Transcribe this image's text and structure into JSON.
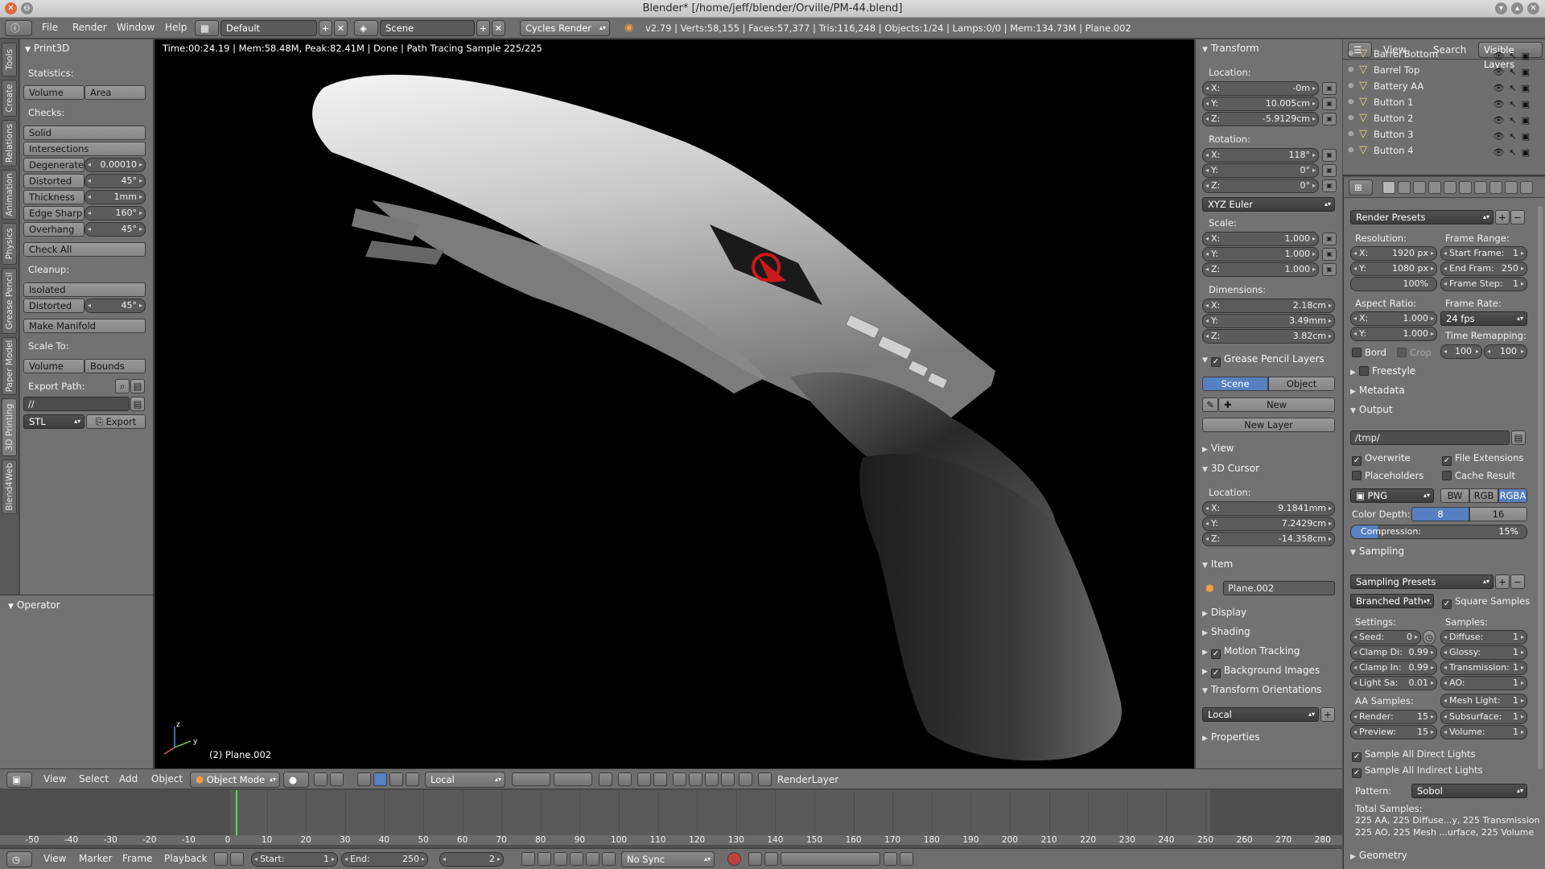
{
  "window": {
    "title": "Blender* [/home/jeff/blender/Orville/PM-44.blend]"
  },
  "infobar": {
    "menus": [
      "File",
      "Render",
      "Window",
      "Help"
    ],
    "layout": "Default",
    "scene": "Scene",
    "engine": "Cycles Render",
    "stats": "v2.79 | Verts:58,155 | Faces:57,377 | Tris:116,248 | Objects:1/24 | Lamps:0/0 | Mem:134.73M | Plane.002"
  },
  "tool_tabs": [
    "Tools",
    "Create",
    "Relations",
    "Animation",
    "Physics",
    "Grease Pencil",
    "Paper Model",
    "3D Printing",
    "Blend4Web"
  ],
  "print3d": {
    "title": "Print3D",
    "statistics_label": "Statistics:",
    "volume": "Volume",
    "area": "Area",
    "checks_label": "Checks:",
    "solid": "Solid",
    "intersections": "Intersections",
    "degenerate": {
      "label": "Degenerate",
      "value": "0.00010"
    },
    "distorted": {
      "label": "Distorted",
      "value": "45°"
    },
    "thickness": {
      "label": "Thickness",
      "value": "1mm"
    },
    "edge_sharp": {
      "label": "Edge Sharp",
      "value": "160°"
    },
    "overhang": {
      "label": "Overhang",
      "value": "45°"
    },
    "check_all": "Check All",
    "cleanup_label": "Cleanup:",
    "isolated": "Isolated",
    "distorted2": {
      "label": "Distorted",
      "value": "45°"
    },
    "make_manifold": "Make Manifold",
    "scale_to_label": "Scale To:",
    "scale_volume": "Volume",
    "scale_bounds": "Bounds",
    "export_path_label": "Export Path:",
    "export_path": "//",
    "format": "STL",
    "export": "Export"
  },
  "operator": {
    "title": "Operator"
  },
  "viewport": {
    "info": "Time:00:24.19 | Mem:58.48M, Peak:82.41M | Done | Path Tracing Sample 225/225",
    "object": "(2) Plane.002",
    "axis_labels": {
      "x": "x",
      "y": "y",
      "z": "z"
    }
  },
  "npanel": {
    "transform": "Transform",
    "location": "Location:",
    "loc": [
      {
        "l": "X:",
        "v": "-0m"
      },
      {
        "l": "Y:",
        "v": "10.005cm"
      },
      {
        "l": "Z:",
        "v": "-5.9129cm"
      }
    ],
    "rotation": "Rotation:",
    "rot": [
      {
        "l": "X:",
        "v": "118°"
      },
      {
        "l": "Y:",
        "v": "0°"
      },
      {
        "l": "Z:",
        "v": "0°"
      }
    ],
    "rot_mode": "XYZ Euler",
    "scale": "Scale:",
    "scl": [
      {
        "l": "X:",
        "v": "1.000"
      },
      {
        "l": "Y:",
        "v": "1.000"
      },
      {
        "l": "Z:",
        "v": "1.000"
      }
    ],
    "dimensions": "Dimensions:",
    "dim": [
      {
        "l": "X:",
        "v": "2.18cm"
      },
      {
        "l": "Y:",
        "v": "3.49mm"
      },
      {
        "l": "Z:",
        "v": "3.82cm"
      }
    ],
    "grease_pencil_layers": "Grease Pencil Layers",
    "gp_scene": "Scene",
    "gp_object": "Object",
    "gp_new": "New",
    "new_layer": "New Layer",
    "view": "View",
    "cursor": "3D Cursor",
    "cursor_location": "Location:",
    "cur": [
      {
        "l": "X:",
        "v": "9.1841mm"
      },
      {
        "l": "Y:",
        "v": "7.2429cm"
      },
      {
        "l": "Z:",
        "v": "-14.358cm"
      }
    ],
    "item": "Item",
    "item_name": "Plane.002",
    "display": "Display",
    "shading": "Shading",
    "motion_tracking": "Motion Tracking",
    "background_images": "Background Images",
    "transform_orientations": "Transform Orientations",
    "orientation": "Local",
    "properties": "Properties"
  },
  "outliner": {
    "view": "View",
    "search": "Search",
    "filter": "Visible Layers",
    "items": [
      "Barrel Bottom",
      "Barrel Top",
      "Battery AA",
      "Button 1",
      "Button 2",
      "Button 3",
      "Button 4"
    ]
  },
  "render": {
    "presets": "Render Presets",
    "resolution": "Resolution:",
    "res_x": {
      "l": "X:",
      "v": "1920 px"
    },
    "res_y": {
      "l": "Y:",
      "v": "1080 px"
    },
    "res_pct": "100%",
    "frame_range": "Frame Range:",
    "start": {
      "l": "Start Frame:",
      "v": "1"
    },
    "end": {
      "l": "End Fram:",
      "v": "250"
    },
    "step": {
      "l": "Frame Step:",
      "v": "1"
    },
    "aspect": "Aspect Ratio:",
    "asp_x": {
      "l": "X:",
      "v": "1.000"
    },
    "asp_y": {
      "l": "Y:",
      "v": "1.000"
    },
    "frame_rate": "Frame Rate:",
    "fps": "24 fps",
    "time_remap": "Time Remapping:",
    "remap_old": "100",
    "remap_new": "100",
    "bord": "Bord",
    "crop": "Crop",
    "freestyle": "Freestyle",
    "metadata": "Metadata",
    "output": "Output",
    "output_path": "/tmp/",
    "overwrite": "Overwrite",
    "file_extensions": "File Extensions",
    "placeholders": "Placeholders",
    "cache_result": "Cache Result",
    "file_format": "PNG",
    "bw": "BW",
    "rgb": "RGB",
    "rgba": "RGBA",
    "color_depth": "Color Depth:",
    "depth8": "8",
    "depth16": "16",
    "compression": {
      "l": "Compression:",
      "v": "15%",
      "fraction": 0.15
    },
    "sampling": "Sampling",
    "sampling_presets": "Sampling Presets",
    "integrator": "Branched Path ...",
    "square_samples": "Square Samples",
    "settings": "Settings:",
    "samples": "Samples:",
    "seed": {
      "l": "Seed:",
      "v": "0"
    },
    "clamp_direct": {
      "l": "Clamp Di:",
      "v": "0.99"
    },
    "clamp_indirect": {
      "l": "Clamp In:",
      "v": "0.99"
    },
    "light_sampling": {
      "l": "Light Sa:",
      "v": "0.01"
    },
    "aa_samples": "AA Samples:",
    "render_samples": {
      "l": "Render:",
      "v": "15"
    },
    "preview_samples": {
      "l": "Preview:",
      "v": "15"
    },
    "diffuse": {
      "l": "Diffuse:",
      "v": "1"
    },
    "glossy": {
      "l": "Glossy:",
      "v": "1"
    },
    "transmission": {
      "l": "Transmission:",
      "v": "1"
    },
    "ao": {
      "l": "AO:",
      "v": "1"
    },
    "mesh_light": {
      "l": "Mesh Light:",
      "v": "1"
    },
    "subsurface": {
      "l": "Subsurface:",
      "v": "1"
    },
    "volume": {
      "l": "Volume:",
      "v": "1"
    },
    "sample_all_direct": "Sample All Direct Lights",
    "sample_all_indirect": "Sample All Indirect Lights",
    "pattern": "Pattern:",
    "pattern_value": "Sobol",
    "total_samples": "Total Samples:",
    "total_line1": "225 AA, 225 Diffuse...y, 225 Transmission",
    "total_line2": "225 AO, 225 Mesh ...urface, 225 Volume",
    "geometry": "Geometry"
  },
  "view3d_header": {
    "menus": [
      "View",
      "Select",
      "Add",
      "Object"
    ],
    "mode": "Object Mode",
    "orientation": "Local",
    "render_layer": "RenderLayer"
  },
  "timeline": {
    "ticks": [
      "-50",
      "-40",
      "-30",
      "-20",
      "-10",
      "0",
      "10",
      "20",
      "30",
      "40",
      "50",
      "60",
      "70",
      "80",
      "90",
      "100",
      "110",
      "120",
      "130",
      "140",
      "150",
      "160",
      "170",
      "180",
      "190",
      "200",
      "210",
      "220",
      "230",
      "240",
      "250",
      "260",
      "270",
      "280"
    ],
    "current_frame": 2
  },
  "timeline_header": {
    "menus": [
      "View",
      "Marker",
      "Frame",
      "Playback"
    ],
    "start": {
      "l": "Start:",
      "v": "1"
    },
    "end": {
      "l": "End:",
      "v": "250"
    },
    "frame": "2",
    "sync": "No Sync"
  },
  "colors": {
    "accent": "#5680c2",
    "background": "#727272",
    "header": "#6e6e6e"
  }
}
